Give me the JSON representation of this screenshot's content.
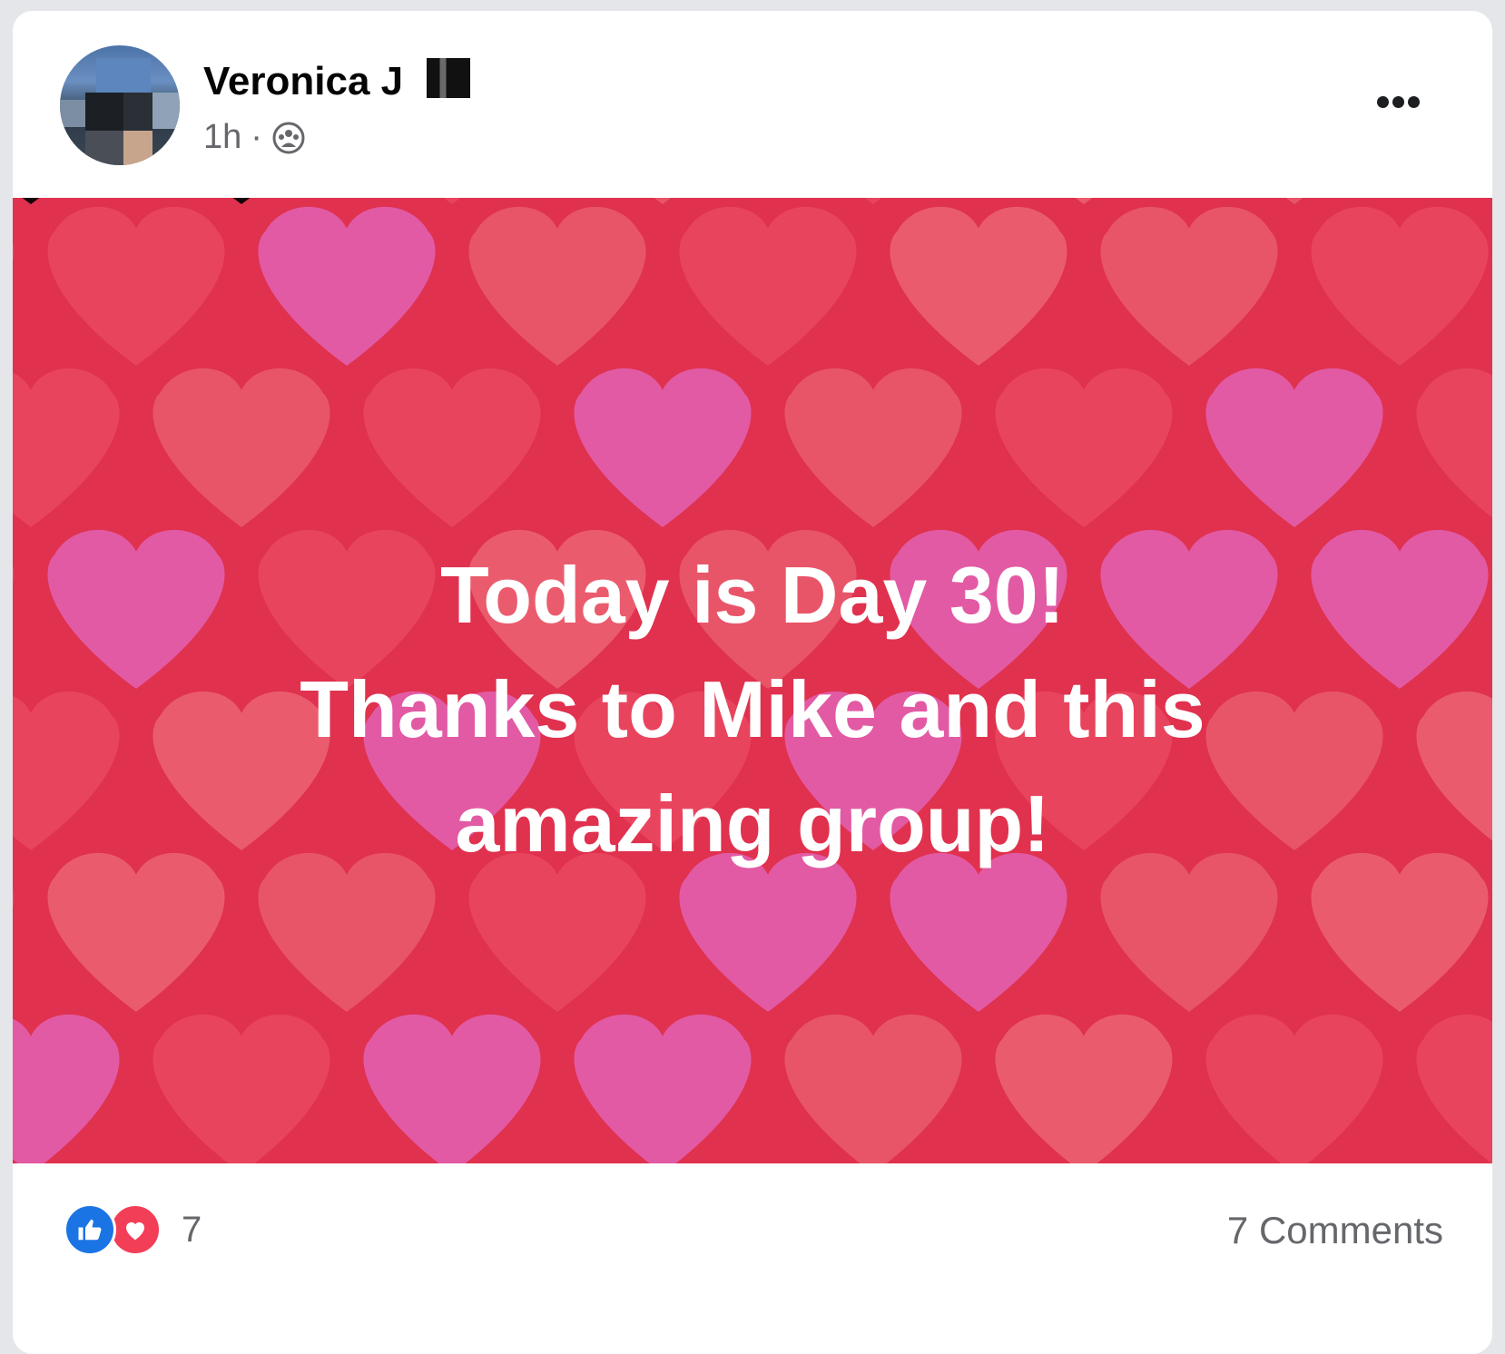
{
  "post": {
    "author": "Veronica J",
    "time": "1h",
    "separator": "·",
    "audience_icon": "group-icon",
    "more_icon": "more-options-icon",
    "banner": {
      "line1": "Today is Day 30!",
      "line2": "Thanks to Mike and this",
      "line3": "amazing group!",
      "background_color": "#e0314e",
      "pattern": "hearts"
    },
    "reactions": {
      "icons": [
        "like-icon",
        "love-icon"
      ],
      "count": "7"
    },
    "comments_label": "7 Comments"
  },
  "colors": {
    "like": "#1b74e4",
    "love": "#f33e58",
    "heart_pink": "#e25dab",
    "heart_light": "#e8586a",
    "heart_mid": "#e94560"
  }
}
